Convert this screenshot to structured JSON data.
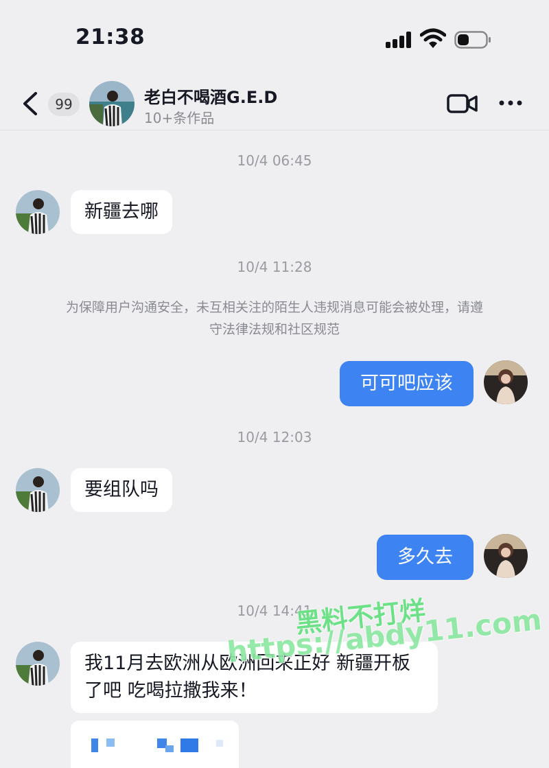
{
  "status_bar": {
    "time": "21:38"
  },
  "header": {
    "unread_count": "99",
    "contact_name": "老白不喝酒G.E.D",
    "contact_subtitle": "10+条作品"
  },
  "messages": [
    {
      "type": "timestamp",
      "text": "10/4 06:45"
    },
    {
      "type": "incoming",
      "text": "新疆去哪"
    },
    {
      "type": "timestamp",
      "text": "10/4 11:28"
    },
    {
      "type": "notice",
      "text": "为保障用户沟通安全，未互相关注的陌生人违规消息可能会被处理，请遵守法律法规和社区规范"
    },
    {
      "type": "outgoing",
      "text": "可可吧应该"
    },
    {
      "type": "timestamp",
      "text": "10/4 12:03"
    },
    {
      "type": "incoming",
      "text": "要组队吗"
    },
    {
      "type": "outgoing",
      "text": "多久去"
    },
    {
      "type": "timestamp",
      "text": "10/4 14:41"
    },
    {
      "type": "incoming",
      "text": "我11月去欧洲从欧洲回来正好 新疆开板了吧 吃喝拉撒我来！"
    }
  ],
  "watermark": {
    "line1": "黑料不打烊",
    "line2": "https://abdy11.com"
  },
  "colors": {
    "background": "#efeff1",
    "outgoing_bubble": "#3d83f2",
    "incoming_bubble": "#ffffff",
    "watermark": "#6ee088"
  }
}
